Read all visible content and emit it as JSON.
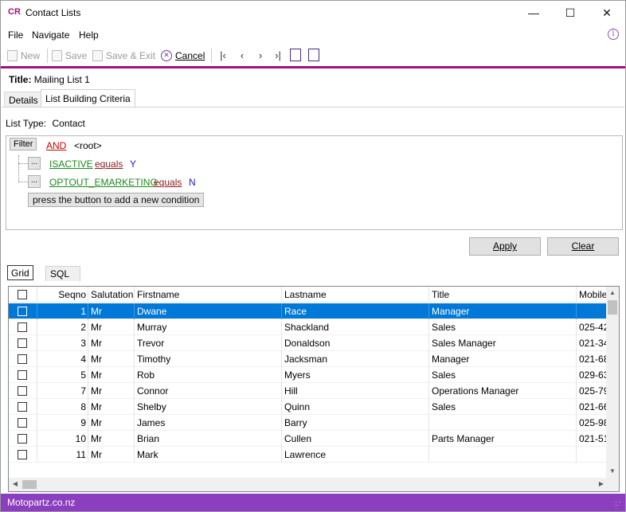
{
  "window": {
    "logo": "CR",
    "title": "Contact Lists",
    "minimize": "—",
    "maximize": "☐",
    "close": "✕"
  },
  "menu": {
    "items": [
      "File",
      "Navigate",
      "Help"
    ],
    "info": "i"
  },
  "toolbar": {
    "new": "New",
    "save": "Save",
    "save_exit": "Save & Exit",
    "cancel": "Cancel"
  },
  "record": {
    "title_label": "Title:",
    "title_value": "Mailing List 1"
  },
  "tabs": [
    "Details",
    "List Building Criteria"
  ],
  "criteria": {
    "list_type_label": "List Type:",
    "list_type_value": "Contact",
    "filter_button": "Filter",
    "root_op": "AND",
    "root_label": "<root>",
    "conditions": [
      {
        "button": "...",
        "field": "ISACTIVE",
        "operator": "equals",
        "value": "Y"
      },
      {
        "button": "...",
        "field": "OPTOUT_EMARKETING",
        "operator": "equals",
        "value": "N"
      }
    ],
    "add_condition": "press the button to add a new condition",
    "apply": "Apply",
    "clear": "Clear"
  },
  "grid_tabs": [
    "Grid",
    "SQL"
  ],
  "grid": {
    "columns": [
      "",
      "Seqno",
      "Salutation",
      "Firstname",
      "Lastname",
      "Title",
      "Mobile"
    ],
    "rows": [
      {
        "seqno": "1",
        "salutation": "Mr",
        "firstname": "Dwane",
        "lastname": "Race",
        "title": "Manager",
        "mobile": "",
        "selected": true
      },
      {
        "seqno": "2",
        "salutation": "Mr",
        "firstname": "Murray",
        "lastname": "Shackland",
        "title": "Sales",
        "mobile": "025-42"
      },
      {
        "seqno": "3",
        "salutation": "Mr",
        "firstname": "Trevor",
        "lastname": "Donaldson",
        "title": "Sales Manager",
        "mobile": "021-34"
      },
      {
        "seqno": "4",
        "salutation": "Mr",
        "firstname": "Timothy",
        "lastname": "Jacksman",
        "title": "Manager",
        "mobile": "021-68"
      },
      {
        "seqno": "5",
        "salutation": "Mr",
        "firstname": "Rob",
        "lastname": "Myers",
        "title": "Sales",
        "mobile": "029-63"
      },
      {
        "seqno": "7",
        "salutation": "Mr",
        "firstname": "Connor",
        "lastname": "Hill",
        "title": "Operations Manager",
        "mobile": "025-79"
      },
      {
        "seqno": "8",
        "salutation": "Mr",
        "firstname": "Shelby",
        "lastname": "Quinn",
        "title": "Sales",
        "mobile": "021-66"
      },
      {
        "seqno": "9",
        "salutation": "Mr",
        "firstname": "James",
        "lastname": "Barry",
        "title": "",
        "mobile": "025-98"
      },
      {
        "seqno": "10",
        "salutation": "Mr",
        "firstname": "Brian",
        "lastname": "Cullen",
        "title": "Parts Manager",
        "mobile": "021-51"
      },
      {
        "seqno": "11",
        "salutation": "Mr",
        "firstname": "Mark",
        "lastname": "Lawrence",
        "title": "",
        "mobile": ""
      }
    ]
  },
  "status": {
    "company": "Motopartz.co.nz"
  },
  "colors": {
    "accent": "#a0127a",
    "status_bar": "#8b3fbf",
    "selection": "#0078d7"
  }
}
